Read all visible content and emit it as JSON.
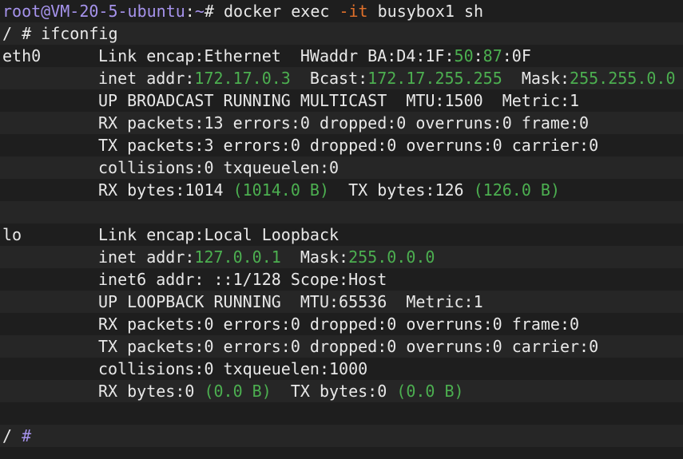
{
  "prompt": {
    "userhost": "root@VM-20-5-ubuntu",
    "sep": ":",
    "path": "~",
    "symbol": "#",
    "cmd_pre": "docker exec ",
    "cmd_flag": "-it",
    "cmd_post": " busybox1 sh"
  },
  "shell": {
    "prompt1": "/ # ",
    "cmd1": "ifconfig",
    "prompt_slash": "/ ",
    "prompt_hash": "#"
  },
  "eth0": {
    "name": "eth0",
    "l1_a": "Link encap:Ethernet  HWaddr BA:D4:1F:",
    "l1_g1": "50",
    "l1_c": ":",
    "l1_g2": "87",
    "l1_d": ":0F",
    "l2_a": "inet addr:",
    "l2_ip": "172.17.0.3",
    "l2_b": "  Bcast:",
    "l2_bcast": "172.17.255.255",
    "l2_c": "  Mask:",
    "l2_mask": "255.255.0.0",
    "l3": "UP BROADCAST RUNNING MULTICAST  MTU:1500  Metric:1",
    "l4": "RX packets:13 errors:0 dropped:0 overruns:0 frame:0",
    "l5": "TX packets:3 errors:0 dropped:0 overruns:0 carrier:0",
    "l6": "collisions:0 txqueuelen:0",
    "l7_a": "RX bytes:1014 ",
    "l7_g1": "(1014.0 B)",
    "l7_b": "  TX bytes:126 ",
    "l7_g2": "(126.0 B)"
  },
  "lo": {
    "name": "lo",
    "l1": "Link encap:Local Loopback",
    "l2_a": "inet addr:",
    "l2_ip": "127.0.0.1",
    "l2_b": "  Mask:",
    "l2_mask": "255.0.0.0",
    "l3": "inet6 addr: ::1/128 Scope:Host",
    "l4": "UP LOOPBACK RUNNING  MTU:65536  Metric:1",
    "l5": "RX packets:0 errors:0 dropped:0 overruns:0 frame:0",
    "l6": "TX packets:0 errors:0 dropped:0 overruns:0 carrier:0",
    "l7": "collisions:0 txqueuelen:1000",
    "l8_a": "RX bytes:0 ",
    "l8_g1": "(0.0 B)",
    "l8_b": "  TX bytes:0 ",
    "l8_g2": "(0.0 B)"
  },
  "colors": {
    "background": "#1e1e1e",
    "text": "#e8e8e8",
    "green": "#4caf50",
    "purple": "#a693ec",
    "orange": "#e0702a"
  }
}
